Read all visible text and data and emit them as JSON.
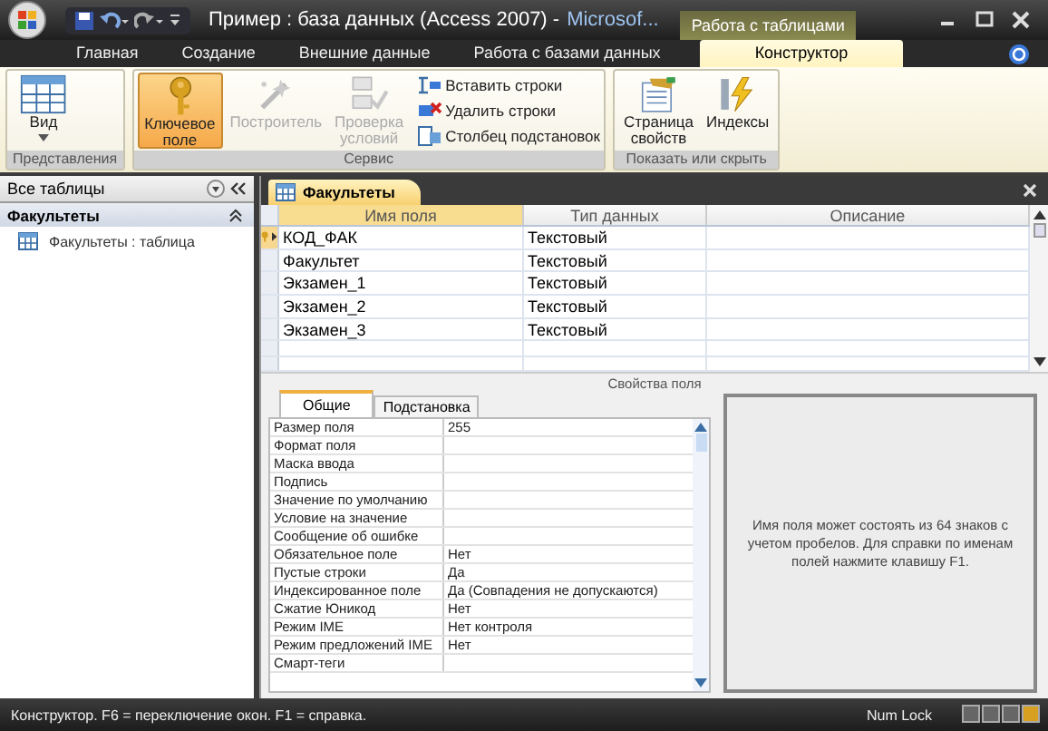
{
  "title_bar": {
    "title": "Пример : база данных (Access 2007) -",
    "app_name": "Microsof...",
    "context_tab": "Работа с таблицами"
  },
  "ribbon_tabs": [
    {
      "label": "Главная",
      "selected": false
    },
    {
      "label": "Создание",
      "selected": false
    },
    {
      "label": "Внешние данные",
      "selected": false
    },
    {
      "label": "Работа с базами данных",
      "selected": false
    },
    {
      "label": "Конструктор",
      "selected": true
    }
  ],
  "ribbon_groups": [
    {
      "label": "Представления",
      "buttons": [
        {
          "kind": "large",
          "lines": [
            "Вид"
          ],
          "dropdown": true,
          "disabled": false,
          "selected": false
        }
      ]
    },
    {
      "label": "Сервис",
      "buttons": [
        {
          "kind": "large",
          "lines": [
            "Ключевое",
            "поле"
          ],
          "disabled": false,
          "selected": true
        },
        {
          "kind": "large",
          "lines": [
            "Построитель"
          ],
          "disabled": true,
          "selected": false
        },
        {
          "kind": "large",
          "lines": [
            "Проверка",
            "условий"
          ],
          "disabled": true,
          "selected": false
        },
        {
          "kind": "small",
          "lines": [
            "Вставить строки"
          ],
          "disabled": false,
          "selected": false
        },
        {
          "kind": "small",
          "lines": [
            "Удалить строки"
          ],
          "disabled": false,
          "selected": false
        },
        {
          "kind": "small",
          "lines": [
            "Столбец  подстановок"
          ],
          "disabled": false,
          "selected": false
        }
      ]
    },
    {
      "label": "Показать или скрыть",
      "buttons": [
        {
          "kind": "large",
          "lines": [
            "Страница",
            "свойств"
          ],
          "disabled": false,
          "selected": false
        },
        {
          "kind": "large",
          "lines": [
            "Индексы"
          ],
          "disabled": false,
          "selected": false
        }
      ]
    }
  ],
  "navigation_pane": {
    "title": "Все таблицы",
    "group": "Факультеты",
    "items": [
      "Факультеты : таблица"
    ]
  },
  "document_tab": "Факультеты",
  "table": {
    "columns": [
      "Имя поля",
      "Тип данных",
      "Описание"
    ],
    "rows": [
      {
        "field": "КОД_ФАК",
        "type": "Текстовый",
        "primary_key": true,
        "current": true
      },
      {
        "field": "Факультет",
        "type": "Текстовый",
        "primary_key": false,
        "current": false
      },
      {
        "field": "Экзамен_1",
        "type": "Текстовый",
        "primary_key": false,
        "current": false
      },
      {
        "field": "Экзамен_2",
        "type": "Текстовый",
        "primary_key": false,
        "current": false
      },
      {
        "field": "Экзамен_3",
        "type": "Текстовый",
        "primary_key": false,
        "current": false
      }
    ]
  },
  "field_properties": {
    "title": "Свойства поля",
    "tabs": [
      {
        "label": "Общие",
        "selected": true
      },
      {
        "label": "Подстановка",
        "selected": false
      }
    ],
    "rows": [
      {
        "name": "Размер поля",
        "value": "255"
      },
      {
        "name": "Формат поля"
      },
      {
        "name": "Маска ввода"
      },
      {
        "name": "Подпись"
      },
      {
        "name": "Значение по умолчанию"
      },
      {
        "name": "Условие на значение"
      },
      {
        "name": "Сообщение об ошибке"
      },
      {
        "name": "Обязательное поле",
        "value": "Нет"
      },
      {
        "name": "Пустые строки",
        "value": "Да"
      },
      {
        "name": "Индексированное поле",
        "value": "Да (Совпадения не допускаются)"
      },
      {
        "name": "Сжатие Юникод",
        "value": "Нет"
      },
      {
        "name": "Режим IME",
        "value": "Нет контроля"
      },
      {
        "name": "Режим предложений IME",
        "value": "Нет"
      },
      {
        "name": "Смарт-теги"
      }
    ],
    "help": "Имя поля может состоять из 64 знаков с учетом пробелов.  Для справки по именам полей нажмите клавишу F1."
  },
  "status_bar": {
    "text": "Конструктор.  F6 = переключение окон.  F1 = справка.",
    "indicator": "Num Lock"
  }
}
